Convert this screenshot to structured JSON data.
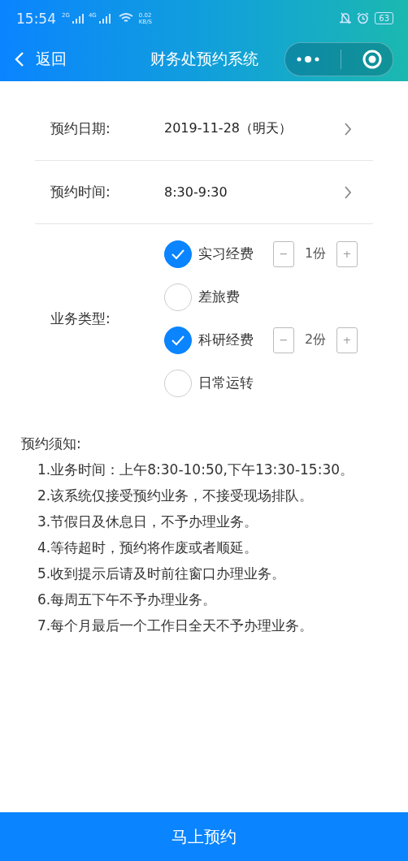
{
  "status_bar": {
    "time": "15:54",
    "network_1": "2G",
    "network_2": "4G",
    "speed_value": "0.02",
    "speed_unit": "KB/S",
    "battery": "63"
  },
  "nav": {
    "back": "返回",
    "title": "财务处预约系统"
  },
  "form": {
    "date": {
      "label": "预约日期:",
      "value": "2019-11-28（明天）"
    },
    "time": {
      "label": "预约时间:",
      "value": "8:30-9:30"
    },
    "type": {
      "label": "业务类型:",
      "options": [
        {
          "label": "实习经费",
          "checked": true,
          "minus": "−",
          "quantity": "1份",
          "plus": "+"
        },
        {
          "label": "差旅费",
          "checked": false
        },
        {
          "label": "科研经费",
          "checked": true,
          "minus": "−",
          "quantity": "2份",
          "plus": "+"
        },
        {
          "label": "日常运转",
          "checked": false
        }
      ]
    }
  },
  "notice": {
    "title": "预约须知:",
    "items": [
      "1.业务时间：上午8:30-10:50,下午13:30-15:30。",
      "2.该系统仅接受预约业务，不接受现场排队。",
      "3.节假日及休息日，不予办理业务。",
      "4.等待超时，预约将作废或者顺延。",
      "5.收到提示后请及时前往窗口办理业务。",
      "6.每周五下午不予办理业务。",
      "7.每个月最后一个工作日全天不予办理业务。"
    ]
  },
  "submit": "马上预约"
}
